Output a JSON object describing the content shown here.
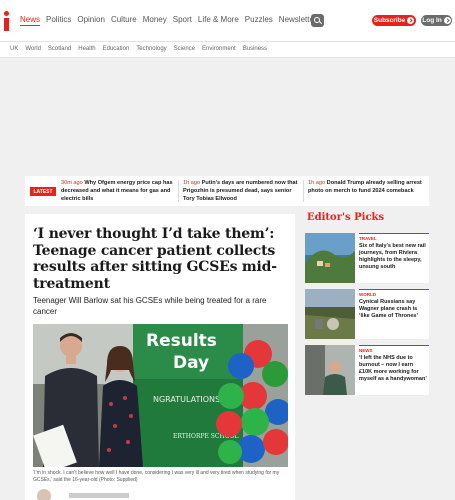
{
  "header": {
    "nav": [
      "News",
      "Politics",
      "Opinion",
      "Culture",
      "Money",
      "Sport",
      "Life & More",
      "Puzzles",
      "Newsletters"
    ],
    "subscribe_label": "Subscribe",
    "login_label": "Log In"
  },
  "subnav": [
    "UK",
    "World",
    "Scotland",
    "Health",
    "Education",
    "Technology",
    "Science",
    "Environment",
    "Business"
  ],
  "latest": {
    "badge": "LATEST",
    "items": [
      {
        "time": "30m ago",
        "text": "Why Ofgem energy price cap has decreased and what it means for gas and electric bills"
      },
      {
        "time": "1h ago",
        "text": "Putin's days are numbered now that Prigozhin is presumed dead, says senior Tory Tobias Ellwood"
      },
      {
        "time": "1h ago",
        "text": "Donald Trump already selling arrest photo on merch to fund 2024 comeback"
      }
    ]
  },
  "article": {
    "headline": "‘I never thought I’d take them’: Teenage cancer patient collects results after sitting GCSEs mid-treatment",
    "standfirst": "Teenager Will Barlow sat his GCSEs while being treated for a rare cancer",
    "banner_word1": "Results",
    "banner_word2": "Day",
    "banner_word3": "NGRATULATIONS",
    "banner_school": "ERTHORPE SCHOOL",
    "caption": "‘I’m in shock. I can’t believe how well I have done, considering I was very ill and very tired when studying for my GCSEs,’ said the 16-year-old (Photo: Supplied)"
  },
  "sidebar": {
    "title": "Editor's Picks",
    "picks": [
      {
        "tag": "TRAVEL",
        "text": "Six of Italy’s best new rail journeys, from Riviera highlights to the sleepy, unsung south"
      },
      {
        "tag": "WORLD",
        "text": "Cynical Russians say Wagner plane crash is ‘like Game of Thrones’"
      },
      {
        "tag": "NEWS",
        "text": "‘I left the NHS due to burnout – now I earn £10K more working for myself as a handywoman’"
      }
    ]
  },
  "colors": {
    "brand": "#e5231b",
    "banner_green": "#1f7a3c"
  }
}
